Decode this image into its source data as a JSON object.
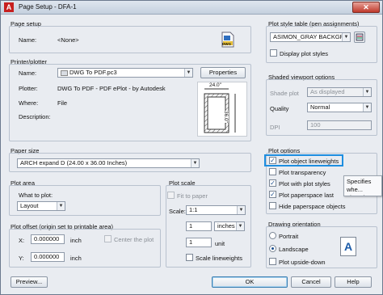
{
  "window": {
    "title": "Page Setup - DFA-1",
    "close_glyph": "✕"
  },
  "page_setup": {
    "group_label": "Page setup",
    "name_label": "Name:",
    "name_value": "<None>"
  },
  "printer": {
    "group_label": "Printer/plotter",
    "name_label": "Name:",
    "name_value": "DWG To PDF.pc3",
    "properties_button": "Properties",
    "plotter_label": "Plotter:",
    "plotter_value": "DWG To PDF - PDF ePlot - by Autodesk",
    "where_label": "Where:",
    "where_value": "File",
    "description_label": "Description:",
    "preview_width": "24.0\"",
    "preview_height": "36.0\""
  },
  "paper_size": {
    "group_label": "Paper size",
    "value": "ARCH expand D (24.00 x 36.00 Inches)"
  },
  "plot_area": {
    "group_label": "Plot area",
    "what_label": "What to plot:",
    "what_value": "Layout"
  },
  "plot_offset": {
    "group_label": "Plot offset (origin set to printable area)",
    "x_label": "X:",
    "x_value": "0.000000",
    "x_unit": "inch",
    "y_label": "Y:",
    "y_value": "0.000000",
    "y_unit": "inch",
    "center_label": "Center the plot"
  },
  "plot_scale": {
    "group_label": "Plot scale",
    "fit_label": "Fit to paper",
    "scale_label": "Scale:",
    "scale_value": "1:1",
    "num_value": "1",
    "num_unit": "inches",
    "den_value": "1",
    "den_unit": "unit",
    "lineweights_label": "Scale lineweights"
  },
  "style_table": {
    "group_label": "Plot style table (pen assignments)",
    "value": "ASIMON_GRAY BACKGROU",
    "display_label": "Display plot styles"
  },
  "shaded": {
    "group_label": "Shaded viewport options",
    "shade_label": "Shade plot",
    "shade_value": "As displayed",
    "quality_label": "Quality",
    "quality_value": "Normal",
    "dpi_label": "DPI",
    "dpi_value": "100"
  },
  "plot_options": {
    "group_label": "Plot options",
    "items": [
      {
        "label": "Plot object lineweights",
        "checked": true
      },
      {
        "label": "Plot transparency",
        "checked": false
      },
      {
        "label": "Plot with plot styles",
        "checked": true
      },
      {
        "label": "Plot paperspace last",
        "checked": true
      },
      {
        "label": "Hide paperspace objects",
        "checked": false
      }
    ]
  },
  "tooltip": {
    "text": "Specifies whe... plotted."
  },
  "orientation": {
    "group_label": "Drawing orientation",
    "portrait_label": "Portrait",
    "landscape_label": "Landscape",
    "upside_label": "Plot upside-down",
    "icon_glyph": "A"
  },
  "footer": {
    "preview_button": "Preview...",
    "ok_button": "OK",
    "cancel_button": "Cancel",
    "help_button": "Help"
  },
  "glyphs": {
    "dropdown": "▼",
    "check": "✓",
    "dwg_badge": "DWG"
  }
}
